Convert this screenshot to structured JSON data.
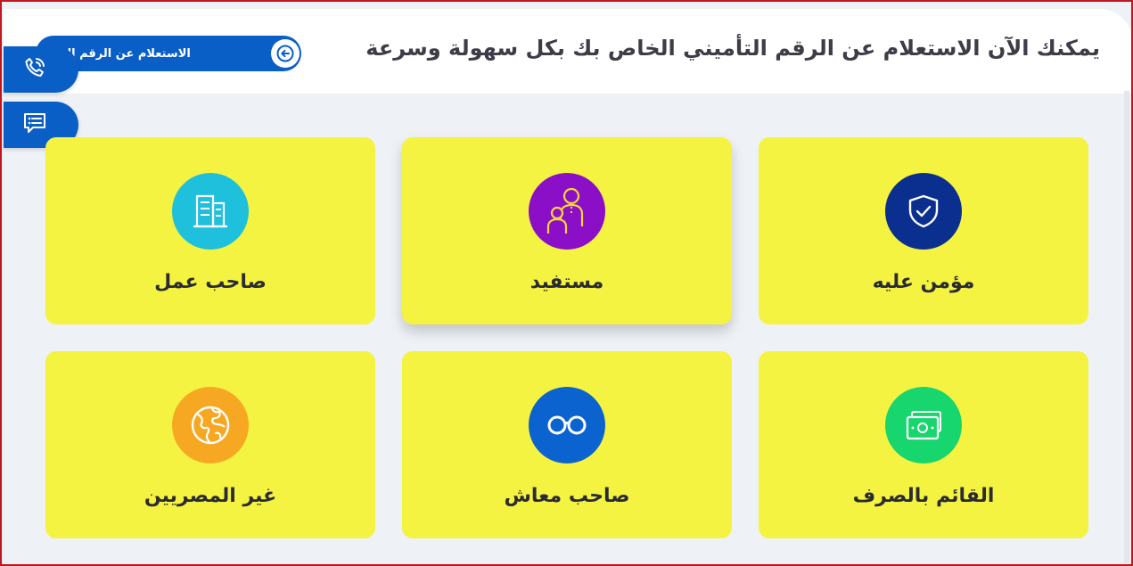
{
  "header": {
    "title": "يمكنك الآن الاستعلام عن الرقم التأميني الخاص بك بكل سهولة وسرعة",
    "inquiry_button_label": "الاستعلام عن الرقم التامين"
  },
  "side_actions": [
    {
      "name": "call",
      "icon": "phone-call-icon"
    },
    {
      "name": "chat",
      "icon": "chat-message-icon"
    }
  ],
  "cards": [
    {
      "label": "مؤمن عليه",
      "icon": "shield-check-icon",
      "color": "#0b2f8f"
    },
    {
      "label": "مستفيد",
      "icon": "beneficiary-family-icon",
      "color": "#8b0fc7"
    },
    {
      "label": "صاحب عمل",
      "icon": "building-icon",
      "color": "#1fc0dc"
    },
    {
      "label": "القائم بالصرف",
      "icon": "cash-icon",
      "color": "#17d66e"
    },
    {
      "label": "صاحب معاش",
      "icon": "glasses-icon",
      "color": "#0b63cf"
    },
    {
      "label": "غير المصريين",
      "icon": "globe-icon",
      "color": "#f7a823"
    }
  ],
  "colors": {
    "primary": "#0a5fc6",
    "card_background": "#f5f342",
    "page_background": "#eef1f5",
    "border": "#c0161d"
  }
}
